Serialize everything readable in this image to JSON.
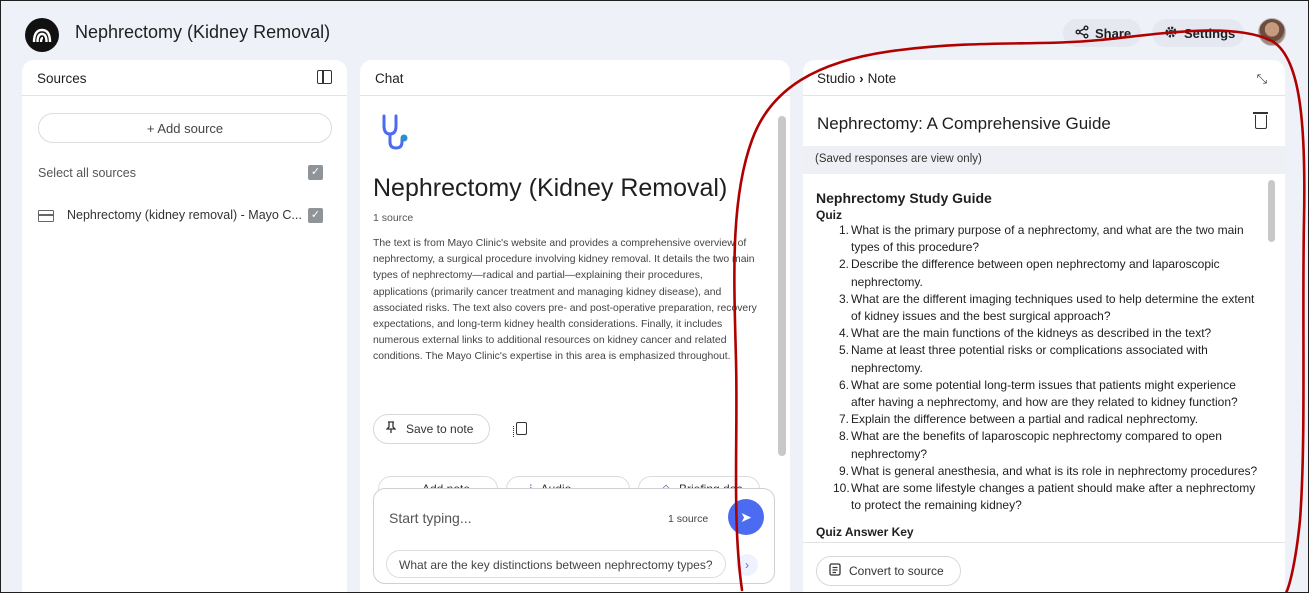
{
  "header": {
    "title": "Nephrectomy (Kidney Removal)",
    "share_label": "Share",
    "settings_label": "Settings"
  },
  "sources": {
    "title": "Sources",
    "add_source_label": "+ Add source",
    "select_all_label": "Select all sources",
    "items": [
      {
        "label": "Nephrectomy (kidney removal) - Mayo C..."
      }
    ]
  },
  "chat": {
    "title": "Chat",
    "heading": "Nephrectomy (Kidney Removal)",
    "source_count": "1 source",
    "summary": "The text is from Mayo Clinic's website and provides a comprehensive overview of nephrectomy, a surgical procedure involving kidney removal. It details the two main types of nephrectomy—radical and partial—explaining their procedures, applications (primarily cancer treatment and managing kidney disease), and associated risks. The text also covers pre- and post-operative preparation, recovery expectations, and long-term kidney health considerations. Finally, it includes numerous external links to additional resources on kidney cancer and related conditions. The Mayo Clinic's expertise in this area is emphasized throughout.",
    "save_note_label": "Save to note",
    "chips": [
      "Add note",
      "Audio",
      "Briefing doc"
    ],
    "composer_placeholder": "Start typing...",
    "composer_count": "1 source",
    "suggestion": "What are the key distinctions between nephrectomy types?"
  },
  "studio": {
    "breadcrumb_root": "Studio",
    "breadcrumb_leaf": "Note",
    "note_title": "Nephrectomy: A Comprehensive Guide",
    "readonly_notice": "(Saved responses are view only)",
    "guide_title": "Nephrectomy Study Guide",
    "quiz_label": "Quiz",
    "quiz": [
      {
        "num": "1.",
        "text": "What is the primary purpose of a nephrectomy, and what are the two main types of this procedure?"
      },
      {
        "num": "2.",
        "text": "Describe the difference between open nephrectomy and laparoscopic nephrectomy."
      },
      {
        "num": "3.",
        "text": "What are the different imaging techniques used to help determine the extent of kidney issues and the best surgical approach?"
      },
      {
        "num": "4.",
        "text": "What are the main functions of the kidneys as described in the text?"
      },
      {
        "num": "5.",
        "text": "Name at least three potential risks or complications associated with nephrectomy."
      },
      {
        "num": "6.",
        "text": "What are some potential long-term issues that patients might experience after having a nephrectomy, and how are they related to kidney function?"
      },
      {
        "num": "7.",
        "text": "Explain the difference between a partial and radical nephrectomy."
      },
      {
        "num": "8.",
        "text": "What are the benefits of laparoscopic nephrectomy compared to open nephrectomy?"
      },
      {
        "num": "9.",
        "text": "What is general anesthesia, and what is its role in nephrectomy procedures?"
      },
      {
        "num": "10.",
        "text": "What are some lifestyle changes a patient should make after a nephrectomy to protect the remaining kidney?"
      }
    ],
    "answer_key_label": "Quiz Answer Key",
    "convert_label": "Convert to source"
  },
  "colors": {
    "background": "#eef1f8",
    "accent": "#4b6cf0",
    "annotation": "#b00000"
  }
}
